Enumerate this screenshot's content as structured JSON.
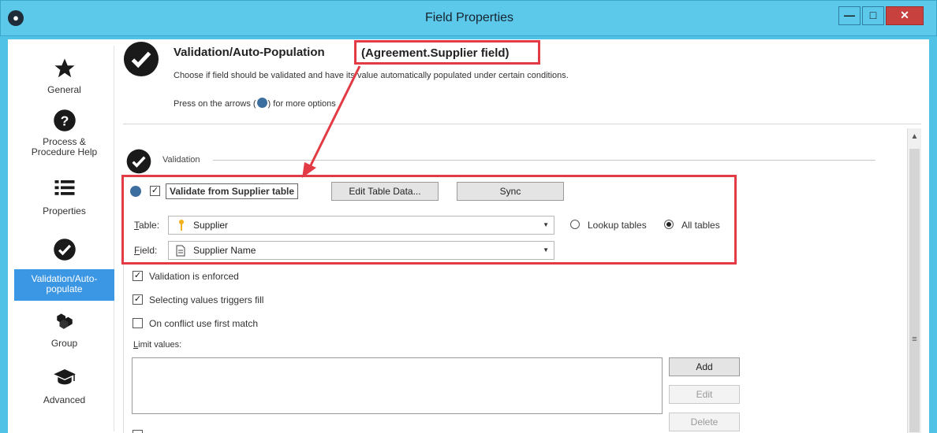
{
  "window": {
    "title": "Field Properties",
    "controls": {
      "minimize": "—",
      "maximize": "□",
      "close": "✕"
    }
  },
  "sidebar": {
    "items": [
      {
        "id": "general",
        "label": "General",
        "icon": "star-icon"
      },
      {
        "id": "process-help",
        "label": "Process &\nProcedure Help",
        "icon": "question-icon"
      },
      {
        "id": "properties",
        "label": "Properties",
        "icon": "list-icon"
      },
      {
        "id": "validation",
        "label": "Validation/Auto-\npopulate",
        "icon": "check-circle-icon",
        "active": true
      },
      {
        "id": "group",
        "label": "Group",
        "icon": "cubes-icon"
      },
      {
        "id": "advanced",
        "label": "Advanced",
        "icon": "graduation-cap-icon"
      }
    ]
  },
  "header": {
    "title": "Validation/Auto-Population",
    "title_field": "(Agreement.Supplier field)",
    "description": "Choose if field should be validated and have its value automatically populated under certain conditions.",
    "arrows_hint_pre": "Press on the arrows (",
    "arrows_hint_post": ") for more options"
  },
  "validation": {
    "section_label": "Validation",
    "validate_from_table": {
      "label": "Validate from Supplier table",
      "checked": true
    },
    "edit_table_button": "Edit Table Data...",
    "sync_button": "Sync",
    "table": {
      "label_accel": "T",
      "label_rest": "able:",
      "value": "Supplier"
    },
    "field": {
      "label_accel": "F",
      "label_rest": "ield:",
      "value": "Supplier Name"
    },
    "radio_lookup": {
      "label": "Lookup tables",
      "selected": false
    },
    "radio_all": {
      "label": "All tables",
      "selected": true
    },
    "enforced": {
      "label": "Validation is enforced",
      "checked": true
    },
    "triggers_fill": {
      "label": "Selecting values triggers fill",
      "checked": true
    },
    "first_match": {
      "label": "On conflict use first match",
      "checked": false
    },
    "limit_values": {
      "label_accel": "L",
      "label_rest": "imit values:"
    },
    "add_button": "Add",
    "edit_button": "Edit",
    "delete_button": "Delete"
  },
  "colors": {
    "titlebar": "#5cc8ea",
    "active_nav": "#3b97e3",
    "highlight_red": "#e23b45",
    "close_button": "#c7413f"
  }
}
